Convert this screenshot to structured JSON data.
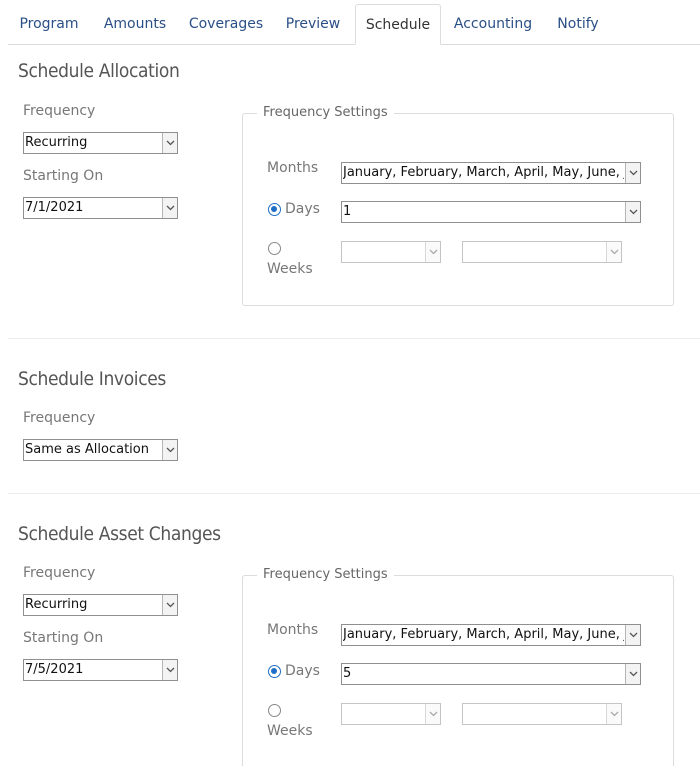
{
  "tabs": [
    {
      "label": "Program"
    },
    {
      "label": "Amounts"
    },
    {
      "label": "Coverages"
    },
    {
      "label": "Preview"
    },
    {
      "label": "Schedule",
      "active": true
    },
    {
      "label": "Accounting"
    },
    {
      "label": "Notify"
    }
  ],
  "allocation": {
    "title": "Schedule Allocation",
    "frequency_label": "Frequency",
    "frequency_value": "Recurring",
    "starting_label": "Starting On",
    "starting_value": "7/1/2021",
    "settings": {
      "legend": "Frequency Settings",
      "months_label": "Months",
      "months_value": "January, February, March, April, May, June, July, August, September, October, November, December",
      "days_label": "Days",
      "days_value": "1",
      "days_selected": true,
      "weeks_label": "Weeks",
      "weeks_value_1": "",
      "weeks_value_2": ""
    }
  },
  "invoices": {
    "title": "Schedule Invoices",
    "frequency_label": "Frequency",
    "frequency_value": "Same as Allocation"
  },
  "asset_changes": {
    "title": "Schedule Asset Changes",
    "frequency_label": "Frequency",
    "frequency_value": "Recurring",
    "starting_label": "Starting On",
    "starting_value": "7/5/2021",
    "settings": {
      "legend": "Frequency Settings",
      "months_label": "Months",
      "months_value": "January, February, March, April, May, June, July, August, September, October, November, December",
      "days_label": "Days",
      "days_value": "5",
      "days_selected": true,
      "weeks_label": "Weeks",
      "weeks_value_1": "",
      "weeks_value_2": ""
    }
  },
  "colors": {
    "tab_link": "#2a4f86",
    "radio_selected": "#1e6ec8",
    "section_title": "#555555",
    "label": "#777777"
  }
}
